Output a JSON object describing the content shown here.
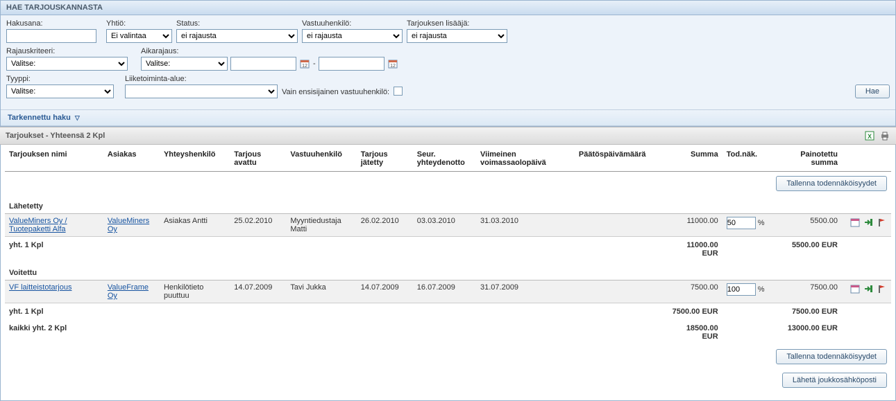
{
  "search": {
    "title": "HAE TARJOUSKANNASTA",
    "hakusana_label": "Hakusana:",
    "hakusana_value": "",
    "yhtio_label": "Yhtiö:",
    "yhtio_value": "Ei valintaa",
    "status_label": "Status:",
    "status_value": "ei rajausta",
    "vastuu_label": "Vastuuhenkilö:",
    "vastuu_value": "ei rajausta",
    "lisaaja_label": "Tarjouksen lisääjä:",
    "lisaaja_value": "ei rajausta",
    "rajaus_label": "Rajauskriteeri:",
    "rajaus_value": "Valitse:",
    "aika_label": "Aikarajaus:",
    "aika_value": "Valitse:",
    "date_from": "",
    "date_to": "",
    "dash": "-",
    "tyyppi_label": "Tyyppi:",
    "tyyppi_value": "Valitse:",
    "liike_label": "Liiketoiminta-alue:",
    "liike_value": "",
    "ensisij_label": "Vain ensisijainen vastuuhenkilö:",
    "hae_button": "Hae",
    "tarkennettu": "Tarkennettu haku"
  },
  "results": {
    "header": "Tarjoukset - Yhteensä 2 Kpl",
    "buttons": {
      "tallenna": "Tallenna todennäköisyydet",
      "laheta": "Lähetä joukkosähköposti"
    },
    "columns": {
      "nimi": "Tarjouksen nimi",
      "asiakas": "Asiakas",
      "yht": "Yhteyshenkilö",
      "avattu": "Tarjous avattu",
      "vastuu": "Vastuuhenkilö",
      "jat": "Tarjous jätetty",
      "seur": "Seur. yhteydenotto",
      "viim": "Viimeinen voimassaolopäivä",
      "paat": "Päätöspäivämäärä",
      "summa": "Summa",
      "tod": "Tod.näk.",
      "painot": "Painotettu summa"
    },
    "sections": [
      {
        "title": "Lähetetty",
        "rows": [
          {
            "nimi": "ValueMiners Oy / Tuotepaketti Alfa",
            "asiakas": "ValueMiners Oy",
            "yht": "Asiakas Antti",
            "avattu": "25.02.2010",
            "vastuu": "Myyntiedustaja Matti",
            "jat": "26.02.2010",
            "seur": "03.03.2010",
            "viim": "31.03.2010",
            "paat": "",
            "summa": "11000.00",
            "prob": "50",
            "pct": "%",
            "painot": "5500.00"
          }
        ],
        "subtotal": {
          "label": "yht. 1 Kpl",
          "summa": "11000.00 EUR",
          "painot": "5500.00 EUR"
        }
      },
      {
        "title": "Voitettu",
        "rows": [
          {
            "nimi": "VF laitteistotarjous",
            "asiakas": "ValueFrame Oy",
            "yht": "Henkilötieto puuttuu",
            "avattu": "14.07.2009",
            "vastuu": "Tavi Jukka",
            "jat": "14.07.2009",
            "seur": "16.07.2009",
            "viim": "31.07.2009",
            "paat": "",
            "summa": "7500.00",
            "prob": "100",
            "pct": "%",
            "painot": "7500.00"
          }
        ],
        "subtotal": {
          "label": "yht. 1 Kpl",
          "summa": "7500.00 EUR",
          "painot": "7500.00 EUR"
        }
      }
    ],
    "grand": {
      "label": "kaikki yht. 2 Kpl",
      "summa": "18500.00 EUR",
      "painot": "13000.00 EUR"
    }
  }
}
